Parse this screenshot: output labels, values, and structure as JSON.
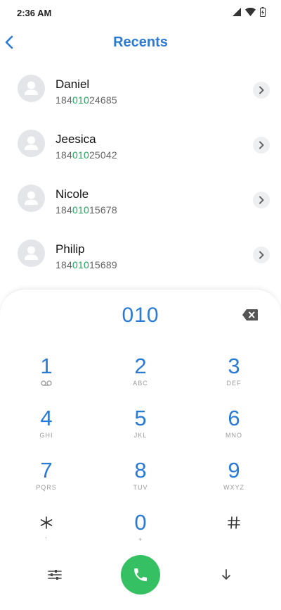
{
  "status_bar": {
    "time": "2:36 AM"
  },
  "header": {
    "title": "Recents",
    "back_icon": "chevron-left-icon"
  },
  "contacts": [
    {
      "name": "Daniel",
      "number_prefix": "184",
      "number_match": "010",
      "number_suffix": "24685"
    },
    {
      "name": "Jeesica",
      "number_prefix": "184",
      "number_match": "010",
      "number_suffix": "25042"
    },
    {
      "name": "Nicole",
      "number_prefix": "184",
      "number_match": "010",
      "number_suffix": "15678"
    },
    {
      "name": "Philip",
      "number_prefix": "184",
      "number_match": "010",
      "number_suffix": "15689"
    }
  ],
  "dialpad": {
    "entered_digits": "010",
    "keys": [
      {
        "digit": "1",
        "letters": ""
      },
      {
        "digit": "2",
        "letters": "ABC"
      },
      {
        "digit": "3",
        "letters": "DEF"
      },
      {
        "digit": "4",
        "letters": "GHI"
      },
      {
        "digit": "5",
        "letters": "JKL"
      },
      {
        "digit": "6",
        "letters": "MNO"
      },
      {
        "digit": "7",
        "letters": "PQRS"
      },
      {
        "digit": "8",
        "letters": "TUV"
      },
      {
        "digit": "9",
        "letters": "WXYZ"
      },
      {
        "digit": "*",
        "letters": "'"
      },
      {
        "digit": "0",
        "letters": "+"
      },
      {
        "digit": "#",
        "letters": ""
      }
    ]
  },
  "colors": {
    "accent_blue": "#2a7bd6",
    "match_green": "#1da75c",
    "call_green": "#35c163"
  }
}
